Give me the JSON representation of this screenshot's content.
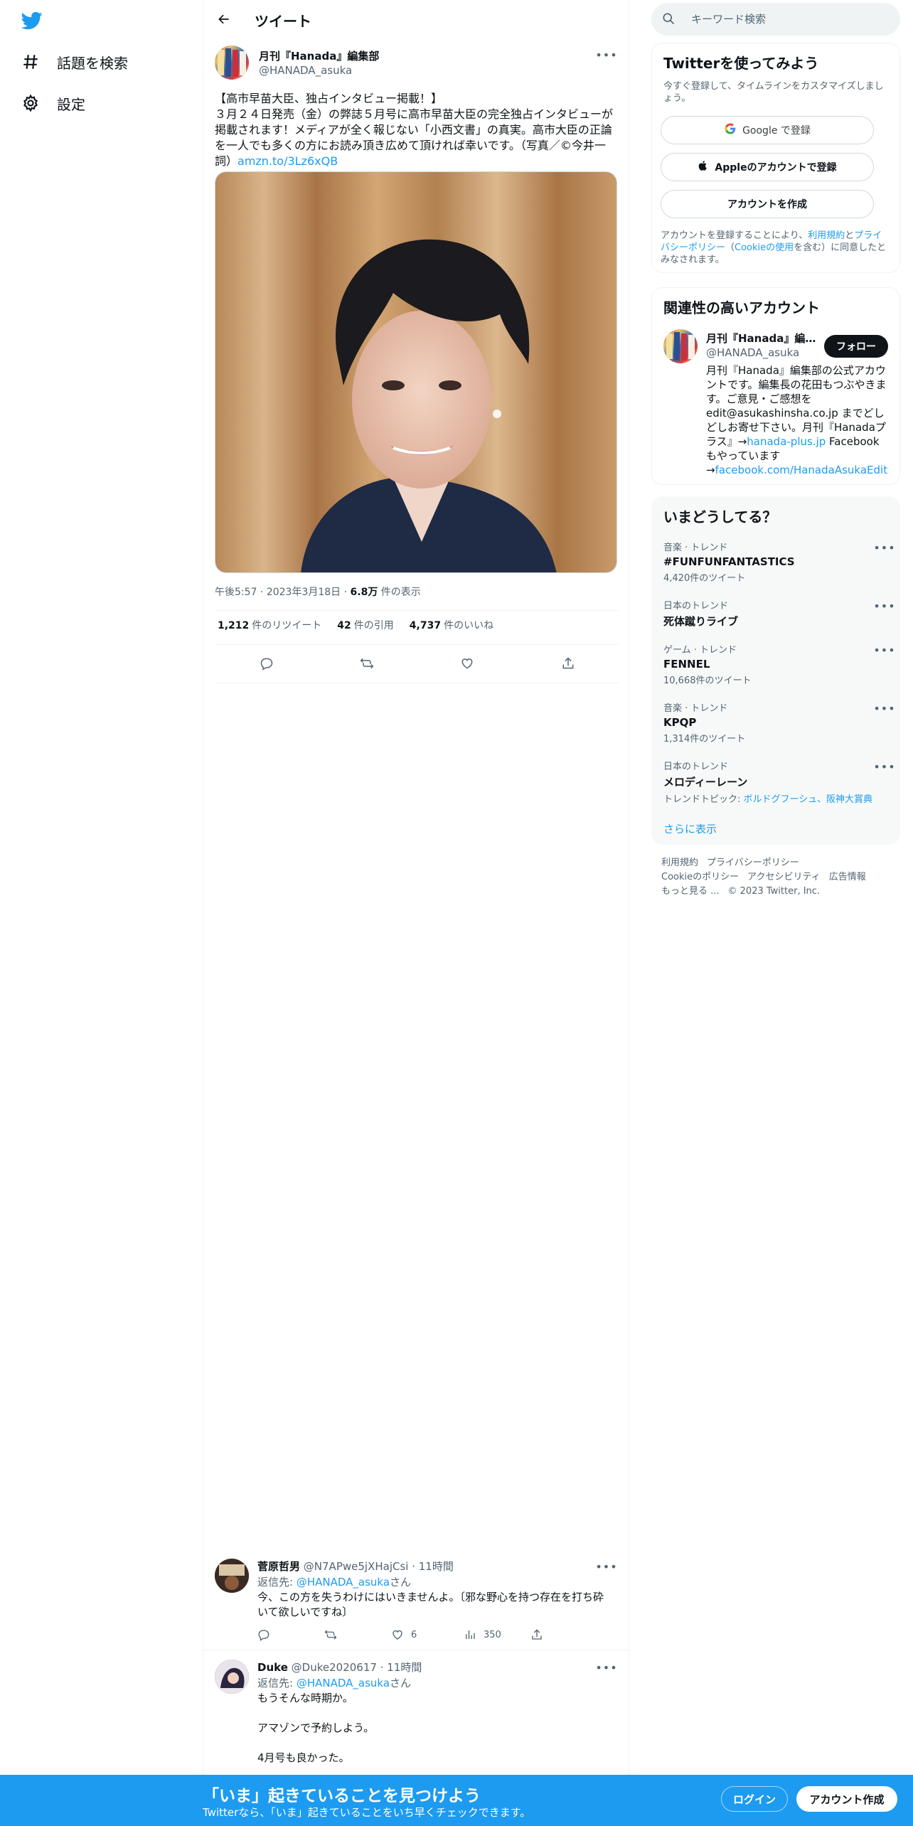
{
  "colors": {
    "accent": "#1d9bf0",
    "text": "#0f1419",
    "secondary": "#536471",
    "border": "#eff3f4"
  },
  "nav": {
    "logo_icon": "twitter-bird-icon",
    "items": [
      {
        "label": "話題を検索",
        "icon": "hashtag-icon"
      },
      {
        "label": "設定",
        "icon": "gear-icon"
      }
    ]
  },
  "header": {
    "title": "ツイート"
  },
  "tweet": {
    "author_name": "月刊『Hanada』編集部",
    "author_handle": "@HANADA_asuka",
    "text": "【高市早苗大臣、独占インタビュー掲載！】\n３月２４日発売（金）の弊誌５月号に高市早苗大臣の完全独占インタビューが掲載されます！メディアが全く報じない「小西文書」の真実。高市大臣の正論を一人でも多くの方にお読み頂き広めて頂ければ幸いです。（写真／©今井一詞）",
    "link": "amzn.to/3Lz6xQB",
    "time": "午後5:57",
    "date": "2023年3月18日",
    "views": "6.8万",
    "views_label": "件の表示",
    "stats": [
      {
        "value": "1,212",
        "label": "件のリツイート"
      },
      {
        "value": "42",
        "label": "件の引用"
      },
      {
        "value": "4,737",
        "label": "件のいいね"
      }
    ]
  },
  "replies": [
    {
      "name": "菅原哲男",
      "handle": "@N7APwe5jXHajCsi",
      "time": "11時間",
      "reply_prefix": "返信先: ",
      "reply_to": "@HANADA_asuka",
      "reply_suffix": "さん",
      "text": "今、この方を失うわけにはいきませんよ。〔邪な野心を持つ存在を打ち砕いて欲しいですね〕",
      "likes": "6",
      "views": "350"
    },
    {
      "name": "Duke",
      "handle": "@Duke2020617",
      "time": "11時間",
      "reply_prefix": "返信先: ",
      "reply_to": "@HANADA_asuka",
      "reply_suffix": "さん",
      "text": "もうそんな時期か。\n\nアマゾンで予約しよう。\n\n4月号も良かった。"
    }
  ],
  "search": {
    "placeholder": "キーワード検索"
  },
  "signup": {
    "title": "Twitterを使ってみよう",
    "subtitle": "今すぐ登録して、タイムラインをカスタマイズしましょう。",
    "google": "Google で登録",
    "apple": "Appleのアカウントで登録",
    "create": "アカウントを作成",
    "terms_1": "アカウントを登録することにより、",
    "terms_link_1": "利用規約",
    "terms_2": "と",
    "terms_link_2": "プライバシーポリシー",
    "terms_3": "（",
    "terms_link_3": "Cookieの使用",
    "terms_4": "を含む）に同意したとみなされます。"
  },
  "related": {
    "title": "関連性の高いアカウント",
    "name": "月刊『Hanada』編集...",
    "handle": "@HANADA_asuka",
    "follow": "フォロー",
    "bio_1": "月刊『Hanada』編集部の公式アカウントです。編集長の花田もつぶやきます。ご意見・ご感想を edit@asukashinsha.co.jp までどしどしお寄せ下さい。月刊『Hanadaプラス』→",
    "bio_link_1": "hanada-plus.jp",
    "bio_2": " Facebookもやっています→",
    "bio_link_2": "facebook.com/HanadaAsukaEdit"
  },
  "trends": {
    "title": "いまどうしてる？",
    "items": [
      {
        "context": "音楽 · トレンド",
        "name": "#FUNFUNFANTASTICS",
        "count": "4,420件のツイート"
      },
      {
        "context": "日本のトレンド",
        "name": "死体蹴りライブ",
        "count": ""
      },
      {
        "context": "ゲーム · トレンド",
        "name": "FENNEL",
        "count": "10,668件のツイート"
      },
      {
        "context": "音楽 · トレンド",
        "name": "KPQP",
        "count": "1,314件のツイート"
      },
      {
        "context": "日本のトレンド",
        "name": "メロディーレーン",
        "count": ""
      }
    ],
    "topic_prefix": "トレンドトピック: ",
    "topic_links": "ボルドグフーシュ、阪神大賞典",
    "show_more": "さらに表示"
  },
  "footer": {
    "links": [
      "利用規約",
      "プライバシーポリシー",
      "Cookieのポリシー",
      "アクセシビリティ",
      "広告情報",
      "もっと見る ..."
    ],
    "copyright": "© 2023 Twitter, Inc."
  },
  "banner": {
    "title": "「いま」起きていることを見つけよう",
    "subtitle": "Twitterなら、「いま」起きていることをいち早くチェックできます。",
    "login": "ログイン",
    "signup": "アカウント作成"
  }
}
